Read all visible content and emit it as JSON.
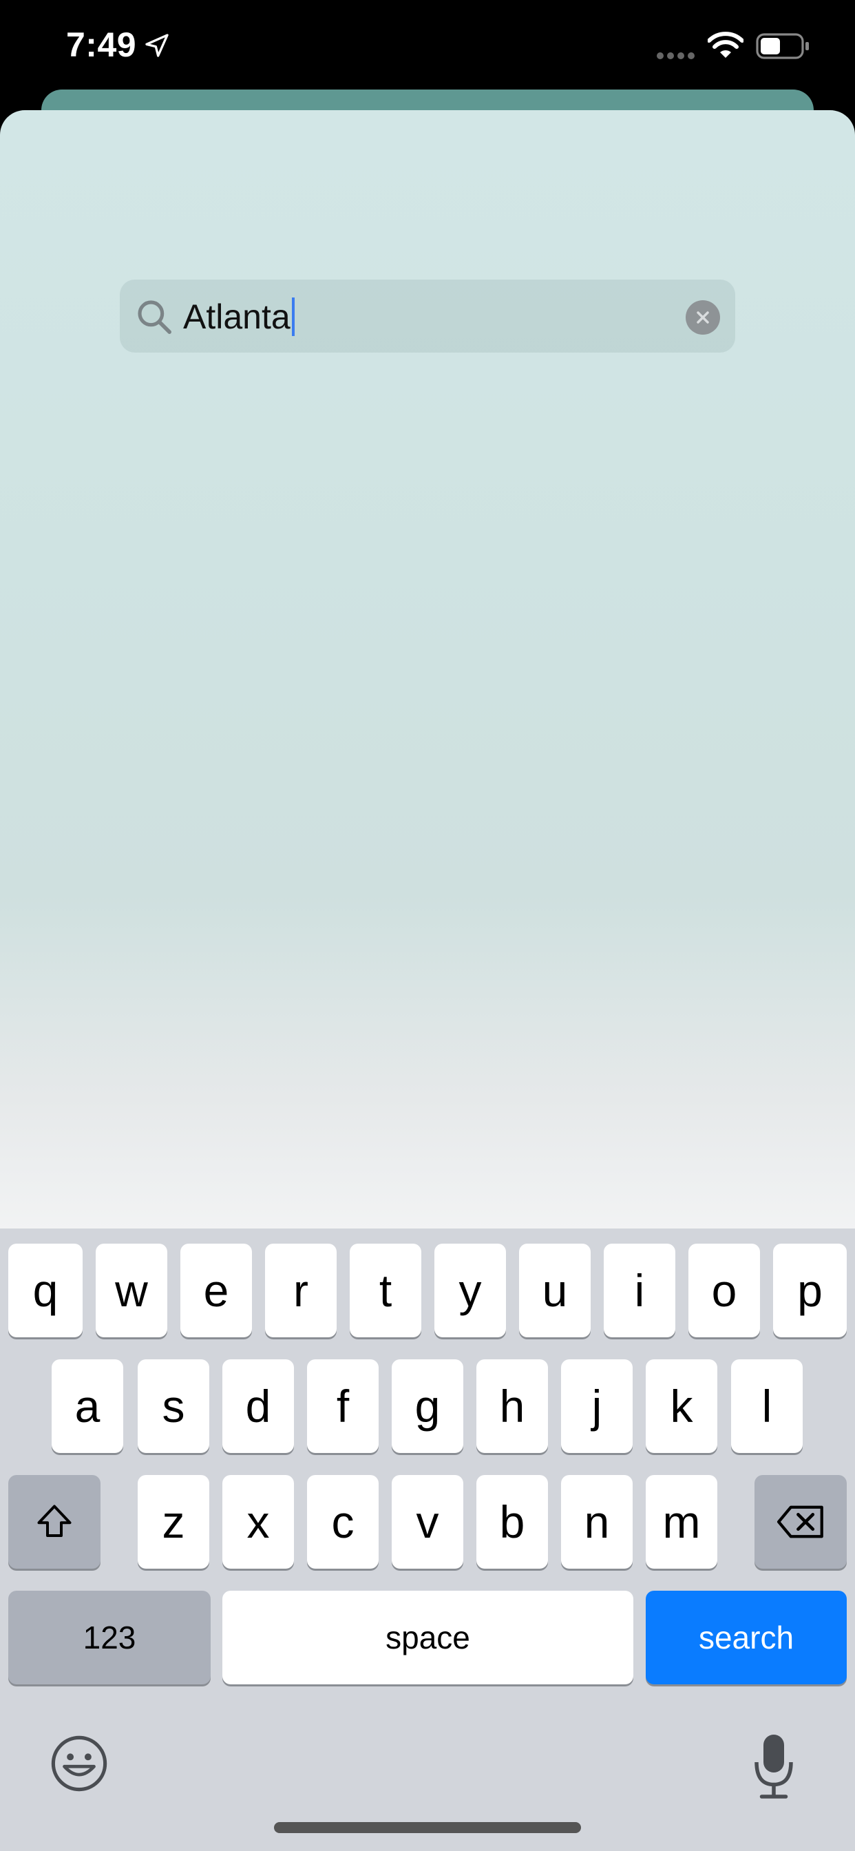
{
  "status_bar": {
    "time": "7:49"
  },
  "search": {
    "query": "Atlanta"
  },
  "keyboard": {
    "row1": [
      "q",
      "w",
      "e",
      "r",
      "t",
      "y",
      "u",
      "i",
      "o",
      "p"
    ],
    "row2": [
      "a",
      "s",
      "d",
      "f",
      "g",
      "h",
      "j",
      "k",
      "l"
    ],
    "row3": [
      "z",
      "x",
      "c",
      "v",
      "b",
      "n",
      "m"
    ],
    "numbers_label": "123",
    "space_label": "space",
    "search_label": "search"
  },
  "colors": {
    "accent": "#0a7cff",
    "sheet_top": "#5f9892"
  }
}
